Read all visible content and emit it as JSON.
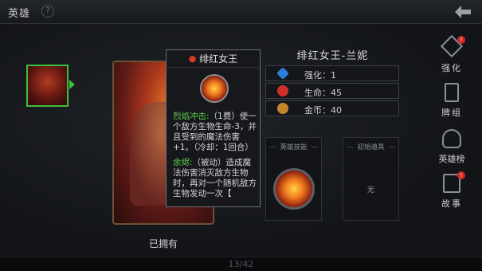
{
  "header": {
    "title": "英雄",
    "help_icon": "question-icon",
    "back_icon": "back-arrow-icon"
  },
  "hero_list": {
    "selected_portrait": "hero-portrait-red-queen",
    "card_status": "已拥有"
  },
  "tooltip": {
    "title": "绯红女王",
    "title_icon": "blood-drop-icon",
    "skill_icon": "fire-orb-icon",
    "ability1_name": "烈焰冲击:",
    "ability1_text": "（1费）使一个敌方生物生命-3，并且受到的魔法伤害+1。（冷却：1回合）",
    "ability2_name": "余烬:",
    "ability2_text": "（被动）造成魔法伤害消灭敌方生物时，再对一个随机敌方生物发动一次【"
  },
  "details": {
    "hero_name": "绯红女王-兰妮",
    "stats": [
      {
        "label": "强化：",
        "value": "1",
        "icon": "enhance-gem-icon"
      },
      {
        "label": "生命：",
        "value": "45",
        "icon": "heart-icon"
      },
      {
        "label": "金币：",
        "value": "40",
        "icon": "gold-coin-icon"
      }
    ],
    "skill_panel_title": "英雄技能",
    "item_panel_title": "初始道具",
    "item_panel_value": "无"
  },
  "side_menu": [
    {
      "label": "强化",
      "icon": "enhance-icon",
      "badge": "!"
    },
    {
      "label": "牌组",
      "icon": "deck-icon",
      "badge": ""
    },
    {
      "label": "英雄榜",
      "icon": "trophy-icon",
      "badge": ""
    },
    {
      "label": "故事",
      "icon": "story-book-icon",
      "badge": "!"
    }
  ],
  "footer": {
    "pager": "13/42"
  },
  "colors": {
    "selection": "#3cbf3c",
    "ability_name": "#5fd14f",
    "badge": "#d32b22"
  }
}
